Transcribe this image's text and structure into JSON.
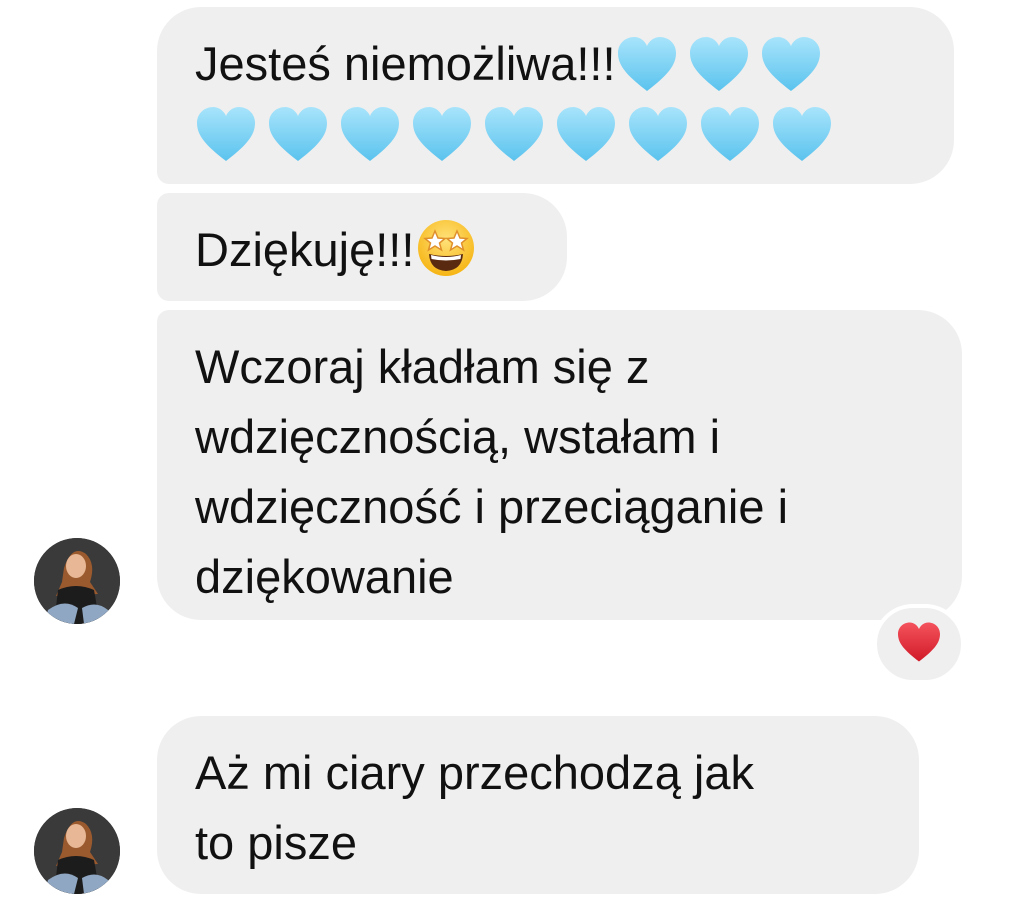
{
  "messages": [
    {
      "text": "Jesteś niemożliwa!!!",
      "emoji": [
        "light-blue-heart",
        "light-blue-heart",
        "light-blue-heart",
        "light-blue-heart",
        "light-blue-heart",
        "light-blue-heart",
        "light-blue-heart",
        "light-blue-heart",
        "light-blue-heart",
        "light-blue-heart",
        "light-blue-heart",
        "light-blue-heart"
      ]
    },
    {
      "text": "Dziękuję!!!",
      "emoji": [
        "star-struck-face"
      ]
    },
    {
      "lines": [
        "Wczoraj kładłam się z",
        "wdzięcznością, wstałam i",
        "wdzięczność i przeciąganie i",
        "dziękowanie"
      ],
      "reaction": "red-heart"
    },
    {
      "lines": [
        "Aż mi ciary przechodzą jak",
        "to pisze"
      ]
    }
  ],
  "colors": {
    "bubble": "#efefef",
    "text": "#111111",
    "light_blue_heart": "#7fd4f5",
    "red_heart": "#e0202d"
  }
}
